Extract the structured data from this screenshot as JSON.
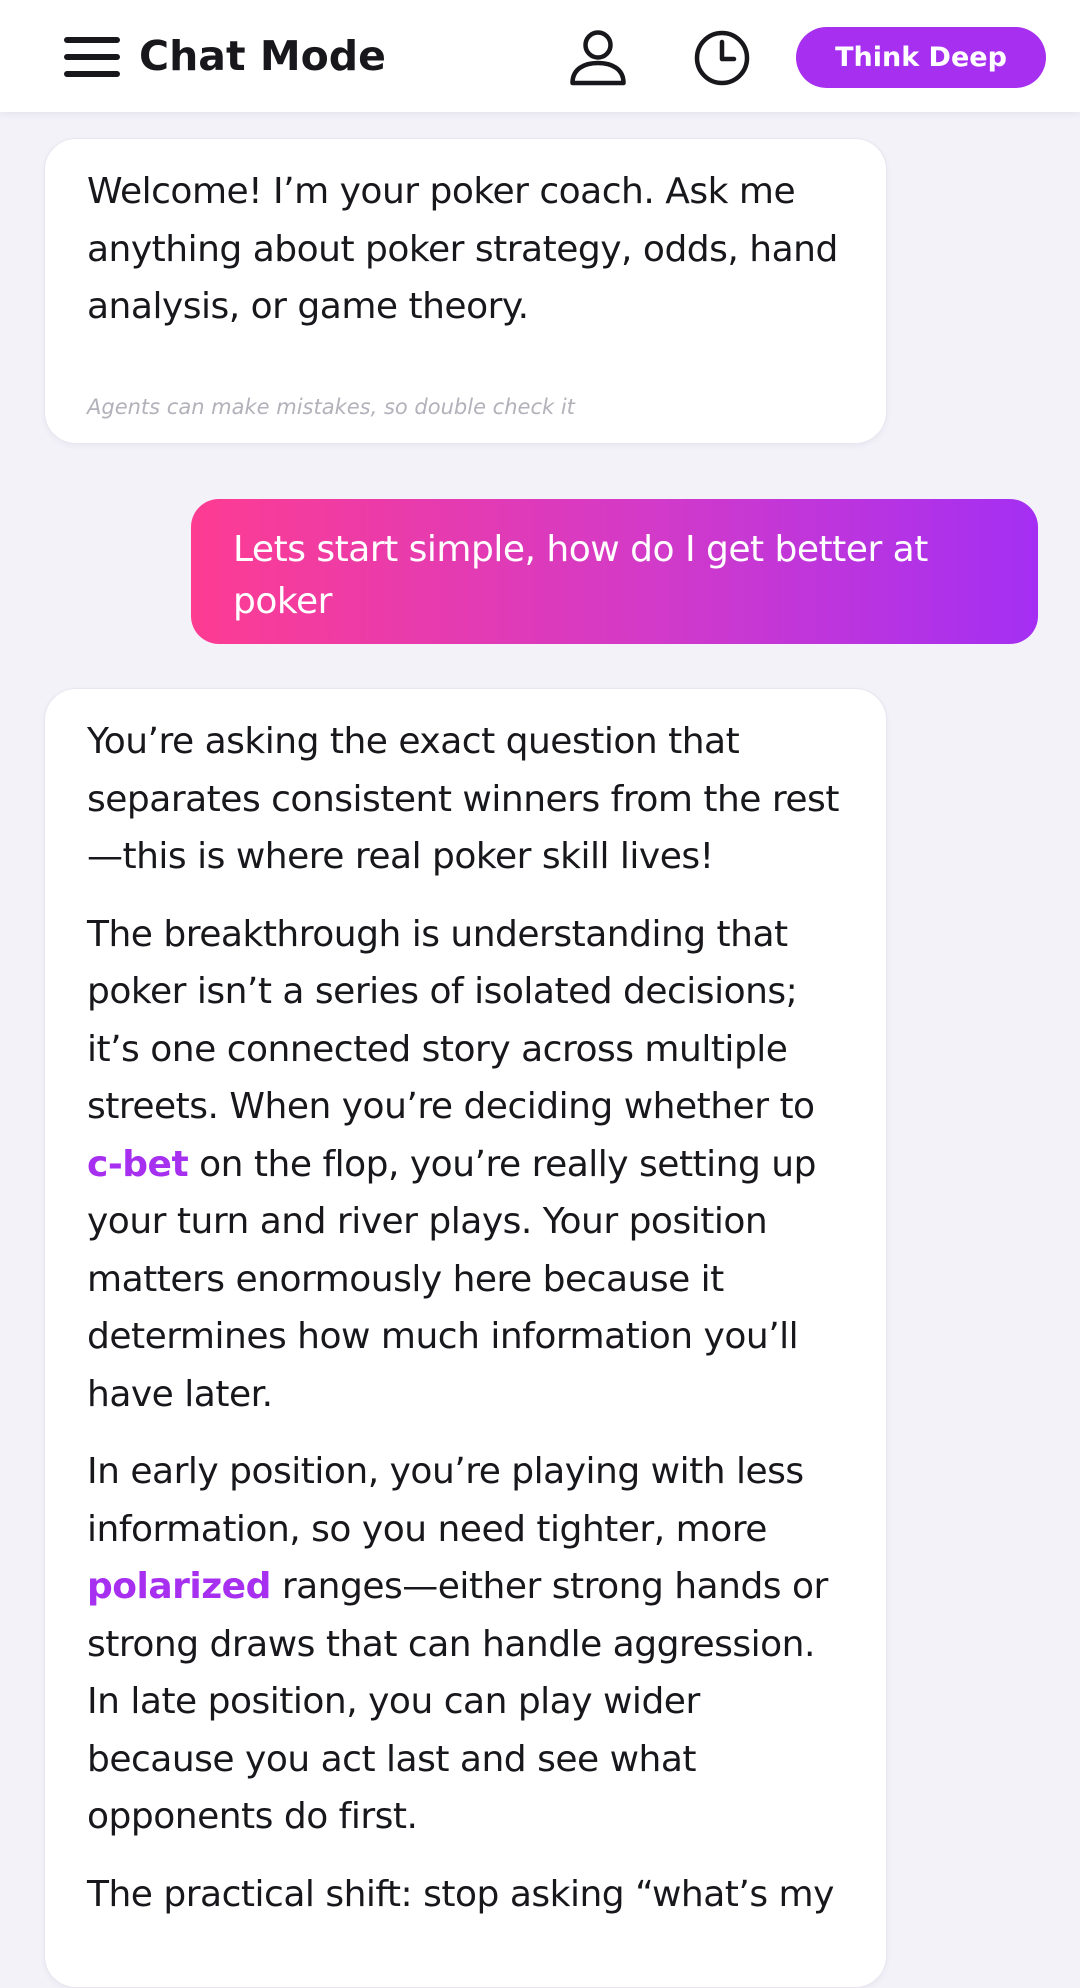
{
  "header": {
    "title": "Chat Mode",
    "think_button_label": "Think Deep",
    "accent_color": "#a62ff0",
    "icons": [
      "menu-icon",
      "user-icon",
      "history-icon"
    ]
  },
  "messages": [
    {
      "role": "assistant",
      "text": "Welcome! I’m your poker coach. Ask me anything about poker strategy, odds, hand analysis, or game theory.",
      "disclaimer": "Agents can make mistakes, so double check it"
    },
    {
      "role": "user",
      "text": "Lets start simple, how do I get better at poker",
      "gradient": [
        "#fd3c92",
        "#a42ff3"
      ]
    },
    {
      "role": "assistant",
      "paragraphs": [
        {
          "text": "You’re asking the exact question that separates consistent winners from the rest—this is where real poker skill lives!"
        },
        {
          "before": "The breakthrough is understanding that poker isn’t a series of isolated decisions; it’s one connected story across multiple streets. When you’re deciding whether to ",
          "term": "c-bet",
          "after": " on the flop, you’re really setting up your turn and river plays. Your position matters enormously here because it determines how much information you’ll have later."
        },
        {
          "before": "In early position, you’re playing with less information, so you need tighter, more ",
          "term": "polarized",
          "after": " ranges—either strong hands or strong draws that can handle aggression. In late position, you can play wider because you act last and see what opponents do first."
        },
        {
          "text": "The practical shift: stop asking “what’s my"
        }
      ]
    }
  ]
}
